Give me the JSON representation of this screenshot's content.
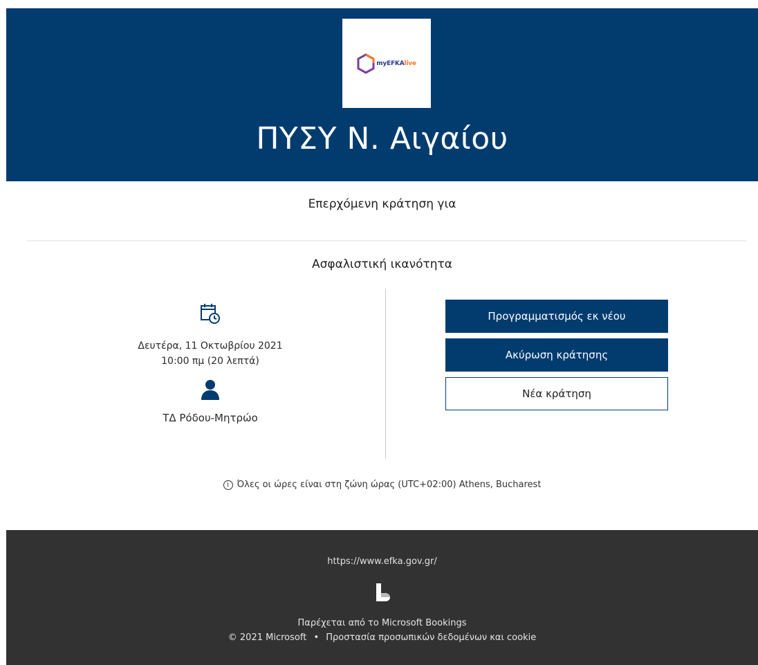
{
  "header": {
    "logo": {
      "brand": "myEFKA",
      "suffix": "live",
      "icon": "efka-hexagon-logo"
    },
    "title": "ΠΥΣΥ Ν. Αιγαίου"
  },
  "booking": {
    "heading": "Επερχόμενη κράτηση για",
    "service_name": "Ασφαλιστική ικανότητα",
    "date": "Δευτέρα, 11 Οκτωβρίου 2021",
    "time": "10:00 πμ (20 λεπτά)",
    "staff": "ΤΔ Ρόδου-Μητρώο",
    "icons": {
      "calendar": "calendar-clock-icon",
      "staff": "person-icon"
    }
  },
  "actions": {
    "reschedule": "Προγραμματισμός εκ νέου",
    "cancel": "Ακύρωση κράτησης",
    "new_booking": "Νέα κράτηση"
  },
  "timezone_note": "Όλες οι ώρες είναι στη ζώνη ώρας (UTC+02:00) Athens, Bucharest",
  "footer": {
    "link": "https://www.efka.gov.gr/",
    "powered_by": "Παρέχεται από το Microsoft Bookings",
    "copyright": "© 2021 Microsoft",
    "separator": "•",
    "privacy": "Προστασία προσωπικών δεδομένων και cookie"
  },
  "colors": {
    "brand_navy": "#023c6f",
    "footer_bg": "#323232",
    "logo_blue": "#2b3990",
    "logo_orange": "#f47920"
  }
}
